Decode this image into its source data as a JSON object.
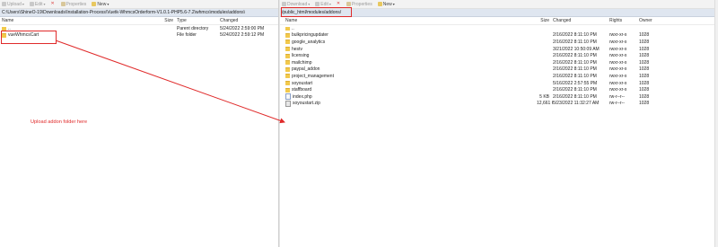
{
  "left": {
    "toolbar": [
      {
        "label": "Upload",
        "icon": "upload-icon"
      },
      {
        "label": "Edit",
        "icon": "edit-icon"
      },
      {
        "label": "",
        "icon": "delete-icon"
      },
      {
        "label": "Properties",
        "icon": "properties-icon"
      },
      {
        "label": "New",
        "icon": "new-icon"
      }
    ],
    "path": "C:\\Users\\ShineO-19\\Downloads\\Installation-Process\\Vuetk-WhmcsOrderform-V1.0.1-PHP5.6-7.2\\whmcs\\modules\\addons\\",
    "columns": {
      "name": "Name",
      "size": "Size",
      "type": "Type",
      "changed": "Changed"
    },
    "rows": [
      {
        "name": "..",
        "size": "",
        "type": "Parent directory",
        "changed": "5/24/2022  2:59:00 PM",
        "icon": "parent-folder-icon"
      },
      {
        "name": "vueWhmcsCart",
        "size": "",
        "type": "File folder",
        "changed": "5/24/2022  2:59:12 PM",
        "icon": "folder-icon"
      }
    ]
  },
  "right": {
    "toolbar": [
      {
        "label": "Download",
        "icon": "download-icon"
      },
      {
        "label": "Edit",
        "icon": "edit-icon"
      },
      {
        "label": "",
        "icon": "delete-icon"
      },
      {
        "label": "Properties",
        "icon": "properties-icon"
      },
      {
        "label": "New",
        "icon": "new-icon"
      }
    ],
    "path": "/public_html/modules/addons/",
    "columns": {
      "name": "Name",
      "size": "Size",
      "changed": "Changed",
      "rights": "Rights",
      "owner": "Owner"
    },
    "rows": [
      {
        "name": "..",
        "size": "",
        "changed": "",
        "rights": "",
        "owner": "",
        "icon": "parent-folder-icon"
      },
      {
        "name": "bulkpricingupdater",
        "size": "",
        "changed": "2/16/2022 8:11:10 PM",
        "rights": "rwxr-xr-x",
        "owner": "1028",
        "icon": "folder-icon"
      },
      {
        "name": "google_analytics",
        "size": "",
        "changed": "2/16/2022 8:11:10 PM",
        "rights": "rwxr-xr-x",
        "owner": "1028",
        "icon": "folder-icon"
      },
      {
        "name": "hestv",
        "size": "",
        "changed": "3/21/2022 10:50:09 AM",
        "rights": "rwxr-xr-x",
        "owner": "1028",
        "icon": "folder-icon"
      },
      {
        "name": "licensing",
        "size": "",
        "changed": "2/16/2022 8:11:10 PM",
        "rights": "rwxr-xr-x",
        "owner": "1028",
        "icon": "folder-icon"
      },
      {
        "name": "mailchimp",
        "size": "",
        "changed": "2/16/2022 8:11:10 PM",
        "rights": "rwxr-xr-x",
        "owner": "1028",
        "icon": "folder-icon"
      },
      {
        "name": "paypal_addon",
        "size": "",
        "changed": "2/16/2022 8:11:10 PM",
        "rights": "rwxr-xr-x",
        "owner": "1028",
        "icon": "folder-icon"
      },
      {
        "name": "project_management",
        "size": "",
        "changed": "2/16/2022 8:11:10 PM",
        "rights": "rwxr-xr-x",
        "owner": "1028",
        "icon": "folder-icon"
      },
      {
        "name": "soyoustart",
        "size": "",
        "changed": "5/16/2022 2:57:55 PM",
        "rights": "rwxr-xr-x",
        "owner": "1028",
        "icon": "folder-icon"
      },
      {
        "name": "staffboard",
        "size": "",
        "changed": "2/16/2022 8:11:10 PM",
        "rights": "rwxr-xr-x",
        "owner": "1028",
        "icon": "folder-icon"
      },
      {
        "name": "index.php",
        "size": "5 KB",
        "changed": "2/16/2022 8:11:10 PM",
        "rights": "rw-r--r--",
        "owner": "1028",
        "icon": "php-file-icon"
      },
      {
        "name": "soyoustart.zip",
        "size": "12,661 KB",
        "changed": "5/23/2022 11:32:27 AM",
        "rights": "rw-r--r--",
        "owner": "1028",
        "icon": "zip-file-icon"
      }
    ]
  },
  "annotation": {
    "note": "Upload addon folder here",
    "color": "#e02a2a"
  }
}
